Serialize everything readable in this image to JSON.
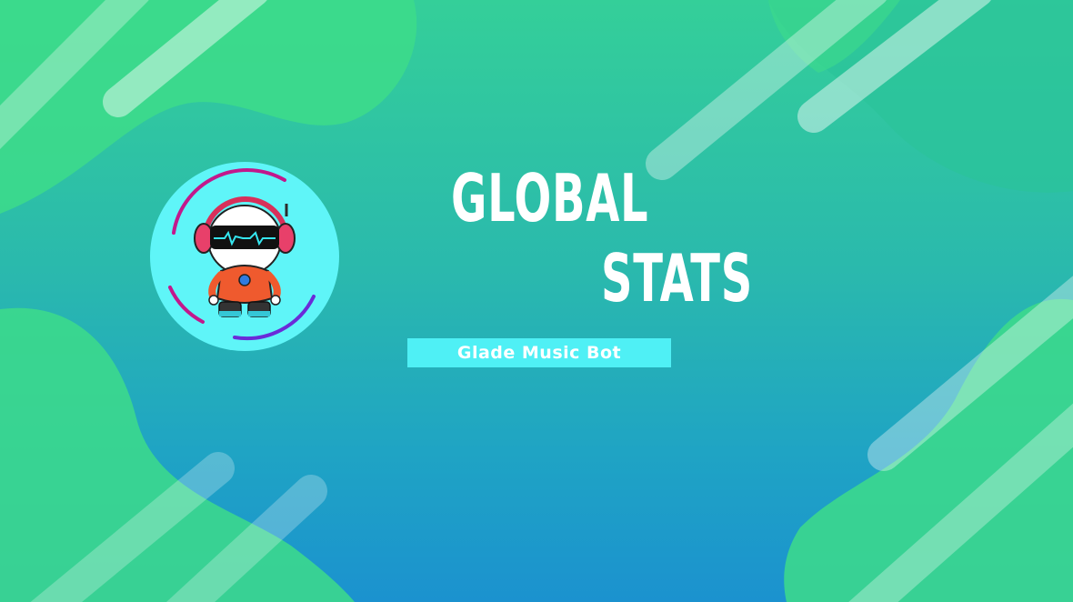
{
  "banner": {
    "title_line_1": "GLOBAL",
    "title_line_2": "STATS",
    "subtitle": "Glade Music Bot"
  },
  "logo": {
    "icon": "robot-dj-avatar-icon"
  },
  "colors": {
    "background_top": "#34cf99",
    "background_bottom": "#1b92cf",
    "blob_green": "#3ddc8a",
    "subtitle_banner": "#4ff0f5",
    "logo_circle": "#5ff5f8",
    "title_text": "#ffffff"
  }
}
